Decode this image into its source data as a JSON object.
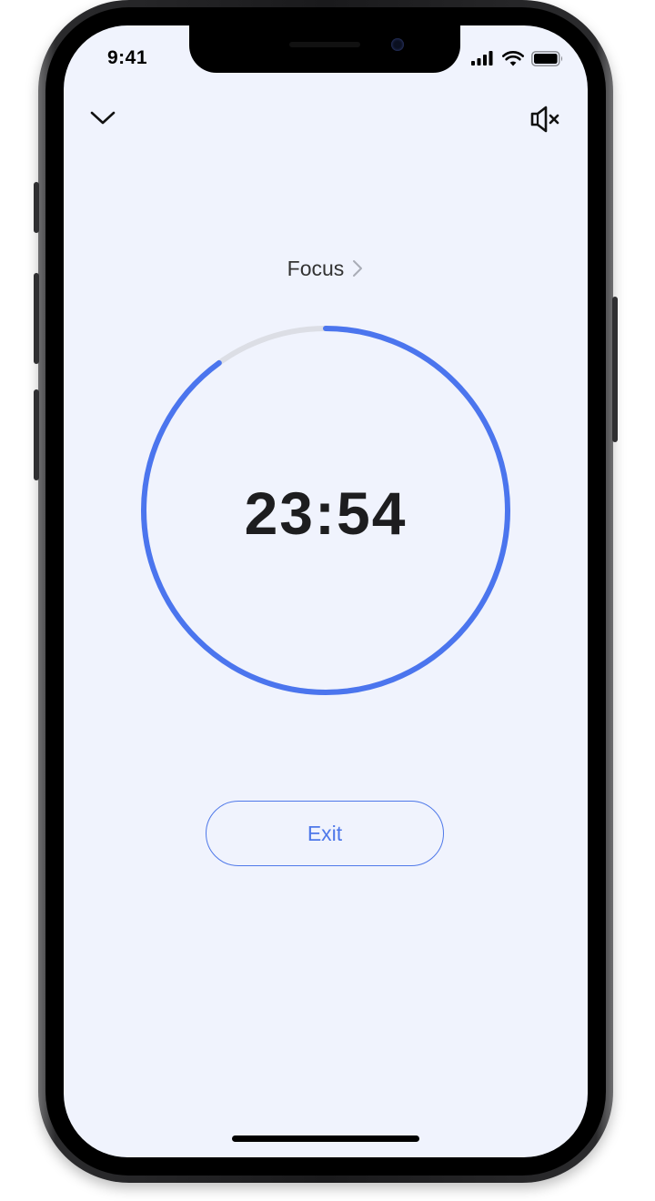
{
  "status_bar": {
    "time": "9:41"
  },
  "timer": {
    "session_label": "Focus",
    "time_remaining": "23:54",
    "progress_fraction": 0.9,
    "ring_color": "#4b75ee",
    "track_color": "#dcdee5"
  },
  "actions": {
    "exit_label": "Exit"
  },
  "icons": {
    "collapse": "chevron-down-icon",
    "sound": "speaker-muted-icon",
    "session_next": "chevron-right-icon"
  },
  "colors": {
    "background": "#f0f3fd",
    "accent": "#4e78e9"
  }
}
